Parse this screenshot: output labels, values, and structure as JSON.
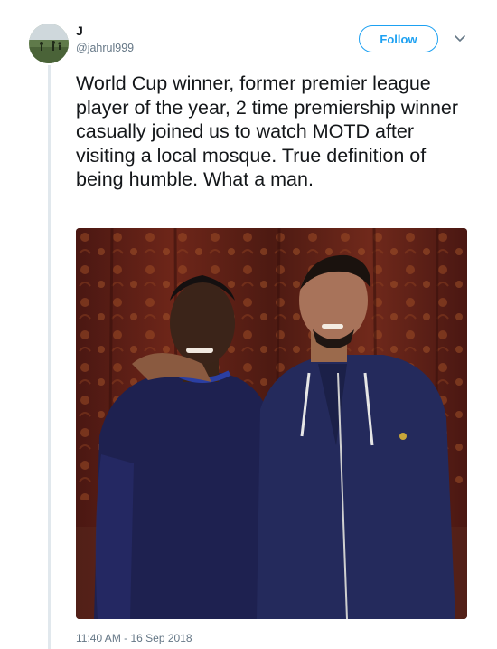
{
  "tweet": {
    "author": {
      "display_name": "J",
      "handle": "@jahrul999",
      "avatar_icon": "avatar-photo"
    },
    "follow_label": "Follow",
    "menu_icon": "chevron-down-icon",
    "text": "World Cup winner, former premier league player of the year, 2 time premiership winner casually joined us to watch MOTD after visiting a local mosque. True definition of being humble. What a man.",
    "media": {
      "type": "photo"
    },
    "timestamp": "11:40 AM - 16 Sep 2018"
  },
  "colors": {
    "accent": "#1da1f2",
    "text_primary": "#14171a",
    "text_secondary": "#657786",
    "rule": "#e1e8ed"
  }
}
